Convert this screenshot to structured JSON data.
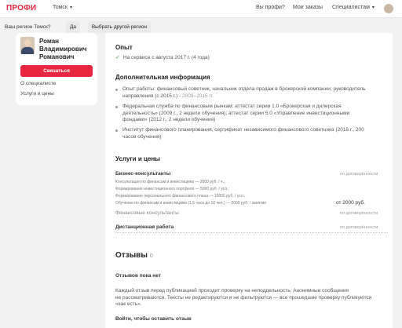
{
  "header": {
    "logo": "ПРОФИ",
    "city": "Томск",
    "nav": [
      "Вы профи?",
      "Мои заказы",
      "Специалистам"
    ]
  },
  "region_prompt": {
    "question": "Ваш регион Томск?",
    "yes": "Да",
    "other": "Выбрать другой регион"
  },
  "profile_card": {
    "name_line1": "Роман",
    "name_line2": "Владимирович",
    "name_line3": "Романович",
    "contact_button": "Связаться",
    "about_link": "О специалисте",
    "services_link": "Услуги и цены"
  },
  "experience": {
    "title": "Опыт",
    "text": "На сервисе с августа 2017 г. (4 года)"
  },
  "additional_info": {
    "title": "Дополнительная информация",
    "items": [
      {
        "line1": "Опыт работы: финансовый советник, начальник отдела продаж в брокерской компании; руководитель",
        "line2": "направления (с 2015 г.) - ",
        "line2_grey": "2009–2015 гг."
      },
      {
        "line1": "Федеральная служба по финансовым рынкам: аттестат серии 1.0 «Брокерская и дилерская",
        "line2": "деятельность» (2009 г., 2 недели обучения); аттестат серии 5.0 «Управление инвестиционными",
        "line3": "фондами» (2012 г., 2 недели обучения)"
      },
      {
        "line1": "Институт финансового планирования, сертификат независимого финансового советника (2016 г., 200",
        "line2": "часов обучения)"
      }
    ]
  },
  "services": {
    "title": "Услуги и цены",
    "group_title": "Бизнес-консультанты",
    "sub_items": [
      "Консультация по финансам и инвестициям — 2000 руб. / ч.;",
      "Формирование инвестиционного портфеля — 5000 руб. / усл.;",
      "Формирование персонального финансового плана — 10000 руб. / усл.;",
      "Обучение по финансам и инвестициям (1,5 часа до 10 чел.) — 2000 руб. / занятие"
    ],
    "price": "от 2000 руб.",
    "rows": [
      {
        "label": "Финансовые консультанты",
        "value": "по договорённости"
      },
      {
        "label": "Дистанционная работа",
        "value": "по договорённости"
      }
    ],
    "first_value": "по договорённости"
  },
  "reviews": {
    "title": "Отзывы",
    "count": "0",
    "none_title": "Отзывов пока нет",
    "policy_line1": "Каждый отзыв перед публикацией проходит проверку на неподдельность. Анонимные сообщения",
    "policy_line2": "не рассматриваются. Тексты не редактируются и не фильтруются — все прошедшие проверку публикуются",
    "policy_line3": "«как есть».",
    "login_link": "Войти, чтобы оставить отзыв"
  }
}
